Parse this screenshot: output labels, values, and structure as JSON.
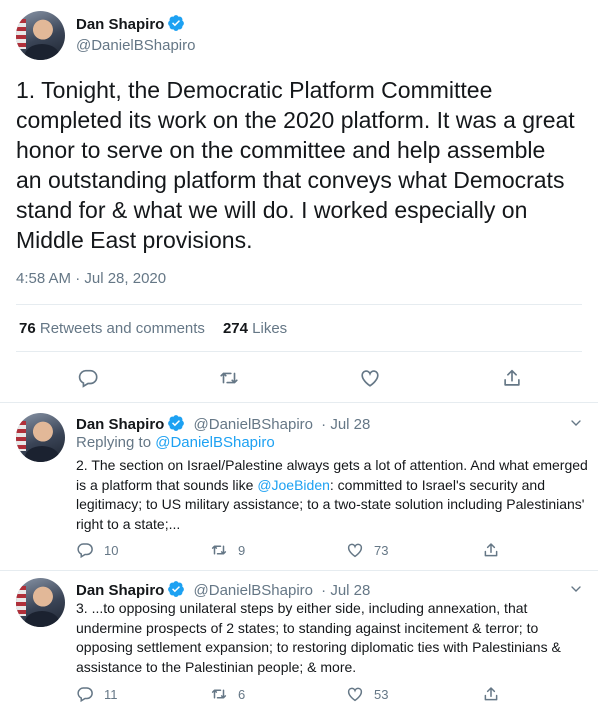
{
  "main_tweet": {
    "author_name": "Dan Shapiro",
    "author_handle": "@DanielBShapiro",
    "text": "1. Tonight, the Democratic Platform Committee completed its work on the 2020 platform. It was a great honor to serve on the committee and help assemble an outstanding platform that conveys what Democrats stand for & what we will do. I worked especially on Middle East provisions.",
    "timestamp": "4:58 AM · Jul 28, 2020",
    "retweets_count": "76",
    "retweets_label": "Retweets and comments",
    "likes_count": "274",
    "likes_label": "Likes"
  },
  "replies": [
    {
      "author_name": "Dan Shapiro",
      "author_handle": "@DanielBShapiro",
      "date": "· Jul 28",
      "replying_prefix": "Replying to",
      "replying_handle": "@DanielBShapiro",
      "text_before": "2. The section on Israel/Palestine always gets a lot of attention. And what emerged is a platform that sounds like ",
      "text_mention": "@JoeBiden",
      "text_after": ": committed to Israel's security and legitimacy; to US military assistance; to a two-state solution including Palestinians' right to a state;...",
      "comments": "10",
      "retweets": "9",
      "likes": "73"
    },
    {
      "author_name": "Dan Shapiro",
      "author_handle": "@DanielBShapiro",
      "date": "· Jul 28",
      "text": "3. ...to opposing unilateral steps by either side, including annexation, that undermine prospects of 2 states; to standing against incitement & terror; to opposing settlement expansion; to restoring diplomatic ties with Palestinians & assistance to the Palestinian people; & more.",
      "comments": "11",
      "retweets": "6",
      "likes": "53"
    }
  ],
  "icons": {
    "verified": "verified-badge-icon",
    "comment": "comment-icon",
    "retweet": "retweet-icon",
    "like": "heart-icon",
    "share": "share-icon",
    "more": "chevron-down-icon"
  },
  "colors": {
    "accent": "#1da1f2",
    "muted": "#657786",
    "text": "#14171a",
    "divider": "#e6ecf0"
  }
}
